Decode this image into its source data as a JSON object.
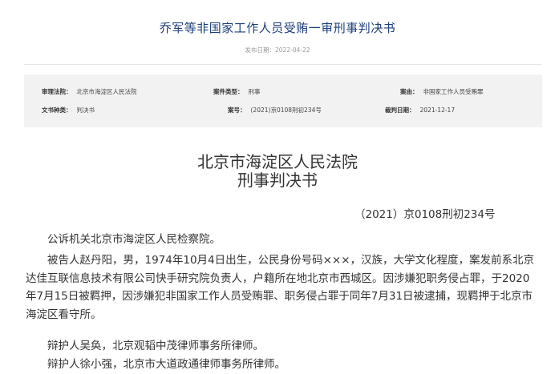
{
  "header": {
    "title": "乔军等非国家工作人员受贿一审刑事判决书",
    "publish_date": "发布日期：2022-04-22"
  },
  "meta": {
    "court_label": "审理法院：",
    "court_value": "北京市海淀区人民法院",
    "case_type_label": "案件类型：",
    "case_type_value": "刑事",
    "cause_label": "案由：",
    "cause_value": "非国家工作人员受贿罪",
    "doc_type_label": "文书种类：",
    "doc_type_value": "判决书",
    "case_no_label": "案号：",
    "case_no_value": "(2021)京0108刑初234号",
    "judge_date_label": "裁判日期：",
    "judge_date_value": "2021-12-17"
  },
  "document": {
    "court_name": "北京市海淀区人民法院",
    "doc_title": "刑事判决书",
    "case_number": "（2021）京0108刑初234号",
    "paragraphs": [
      "公诉机关北京市海淀区人民检察院。",
      "被告人赵丹阳，男，1974年10月4日出生，公民身份号码×××，汉族，大学文化程度，案发前系北京达佳互联信息技术有限公司快手研究院负责人，户籍所在地北京市西城区。因涉嫌犯职务侵占罪，于2020年7月15日被羁押，因涉嫌犯非国家工作人员受贿罪、职务侵占罪于同年7月31日被逮捕，现羁押于北京市海淀区看守所。",
      "辩护人吴奂，北京观韬中茂律师事务所律师。",
      "辩护人徐小强，北京市大道政通律师事务所律师。"
    ]
  }
}
